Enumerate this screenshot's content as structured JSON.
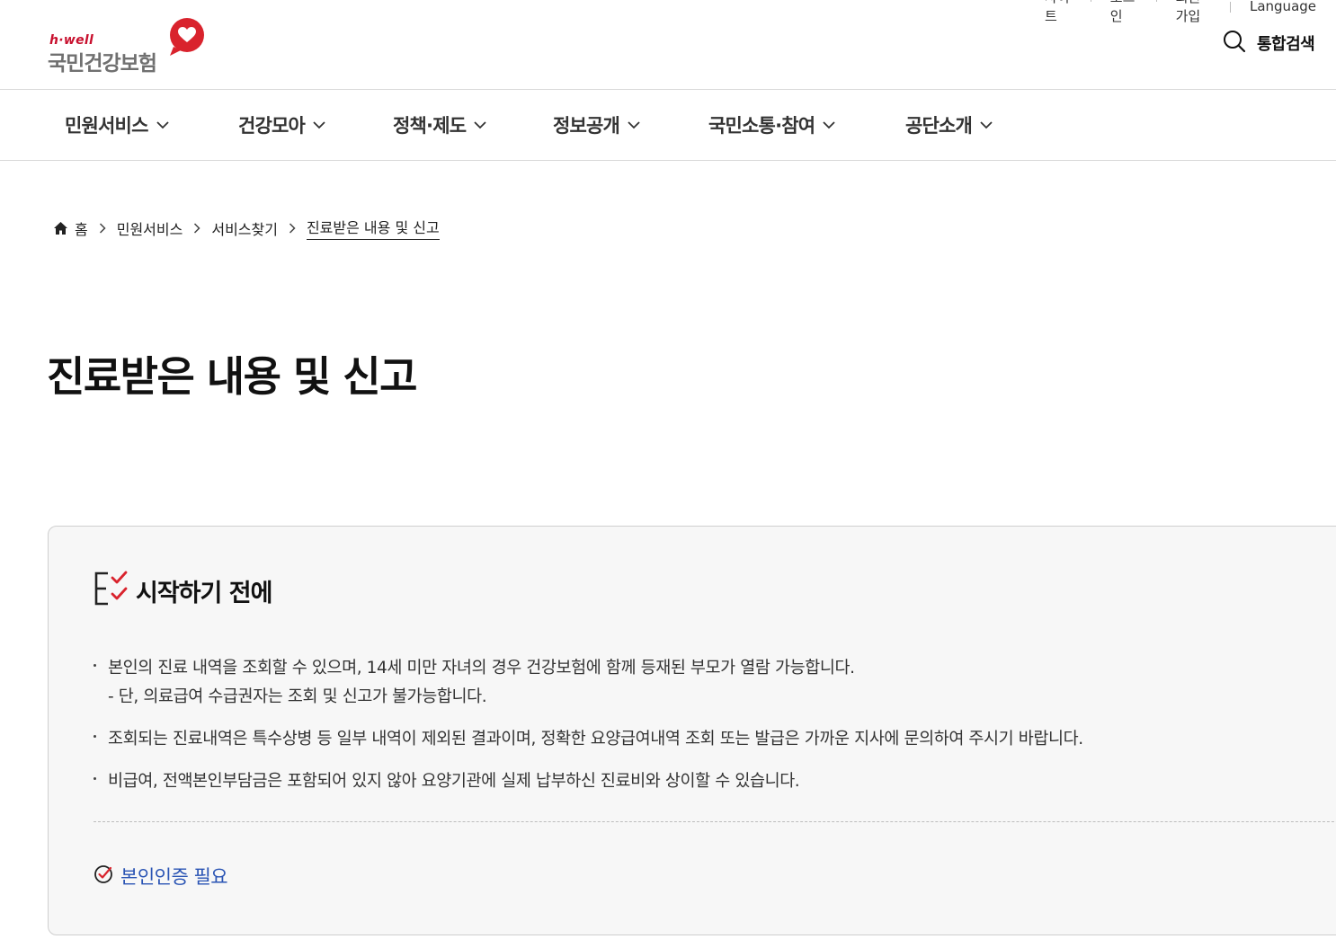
{
  "utility": {
    "items": [
      "사이트",
      "로그인",
      "회원가입",
      "Language"
    ]
  },
  "header": {
    "logo_small": "h·well",
    "logo_main": "국민건강보험",
    "search_label": "통합검색"
  },
  "gnb": {
    "items": [
      {
        "label": "민원서비스"
      },
      {
        "label": "건강모아"
      },
      {
        "label": "정책·제도"
      },
      {
        "label": "정보공개"
      },
      {
        "label": "국민소통·참여"
      },
      {
        "label": "공단소개"
      }
    ]
  },
  "breadcrumb": {
    "home": "홈",
    "items": [
      "민원서비스",
      "서비스찾기",
      "진료받은 내용 및 신고"
    ]
  },
  "page": {
    "title": "진료받은 내용 및 신고"
  },
  "notice": {
    "title": "시작하기 전에",
    "items": [
      {
        "text": "본인의 진료 내역을 조회할 수 있으며, 14세 미만 자녀의 경우 건강보험에 함께 등재된 부모가 열람 가능합니다.",
        "sub": "- 단, 의료급여 수급권자는 조회 및 신고가 불가능합니다."
      },
      {
        "text": "조회되는 진료내역은 특수상병 등 일부 내역이 제외된 결과이며, 정확한 요양급여내역 조회 또는 발급은 가까운 지사에 문의하여 주시기 바랍니다."
      },
      {
        "text": "비급여, 전액본인부담금은 포함되어 있지 않아 요양기관에 실제 납부하신 진료비와 상이할 수 있습니다."
      }
    ],
    "auth_label": "본인인증 필요"
  },
  "colors": {
    "brand_red": "#c8102e",
    "link_blue": "#2a54b4",
    "box_bg": "#f7f7f7"
  },
  "icons": [
    "heart-icon",
    "search-icon",
    "chevron-down-icon",
    "home-icon",
    "chevron-right-icon",
    "checklist-icon",
    "check-circle-icon"
  ]
}
